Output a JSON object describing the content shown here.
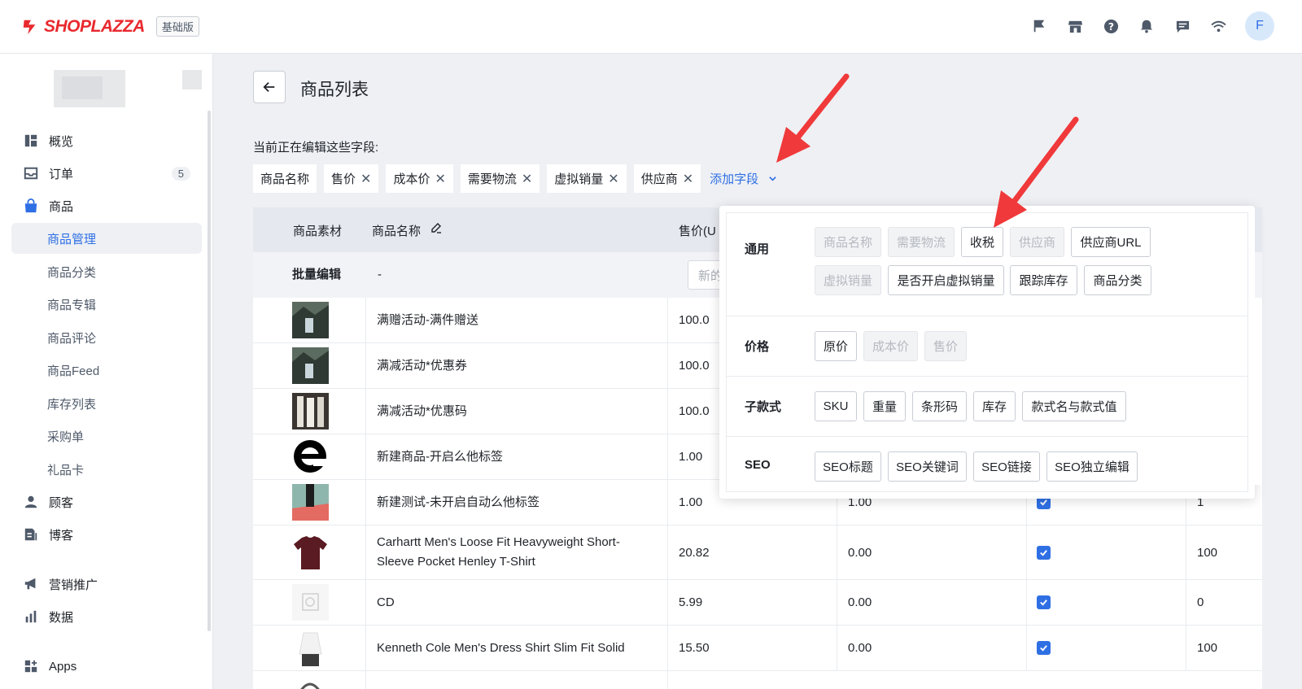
{
  "header": {
    "logo_text": "SHOPLAZZA",
    "plan_badge": "基础版",
    "avatar_letter": "F",
    "icons": [
      "flag-icon",
      "store-icon",
      "help-icon",
      "bell-icon",
      "message-icon",
      "wifi-icon"
    ]
  },
  "sidebar": {
    "items": [
      {
        "label": "概览",
        "icon": "dashboard-icon"
      },
      {
        "label": "订单",
        "icon": "inbox-icon",
        "count": "5"
      },
      {
        "label": "商品",
        "icon": "shopping-bag-icon"
      },
      {
        "label": "顾客",
        "icon": "person-icon"
      },
      {
        "label": "博客",
        "icon": "blog-icon"
      },
      {
        "label": "营销推广",
        "icon": "megaphone-icon"
      },
      {
        "label": "数据",
        "icon": "bar-chart-icon"
      },
      {
        "label": "Apps",
        "icon": "apps-icon"
      }
    ],
    "product_sub": [
      "商品管理",
      "商品分类",
      "商品专辑",
      "商品评论",
      "商品Feed",
      "库存列表",
      "采购单",
      "礼品卡"
    ]
  },
  "main": {
    "title": "商品列表",
    "editing_label": "当前正在编辑这些字段:",
    "chips": [
      {
        "label": "商品名称",
        "removable": false
      },
      {
        "label": "售价",
        "removable": true
      },
      {
        "label": "成本价",
        "removable": true
      },
      {
        "label": "需要物流",
        "removable": true
      },
      {
        "label": "虚拟销量",
        "removable": true
      },
      {
        "label": "供应商",
        "removable": true
      }
    ],
    "add_field": "添加字段"
  },
  "table": {
    "headers": {
      "material": "商品素材",
      "name": "商品名称",
      "price": "售价(U"
    },
    "batch_label": "批量编辑",
    "batch_dash": "-",
    "batch_placeholder": "新的",
    "rows": [
      {
        "name": "满赠活动-满件赠送",
        "price": "100.0",
        "cost": "",
        "virtual": ""
      },
      {
        "name": "满减活动*优惠券",
        "price": "100.0",
        "cost": "",
        "virtual": ""
      },
      {
        "name": "满减活动*优惠码",
        "price": "100.0",
        "cost": "",
        "virtual": ""
      },
      {
        "name": "新建商品-开启么他标签",
        "price": "1.00",
        "cost": "",
        "virtual": ""
      },
      {
        "name": "新建测试-未开启自动么他标签",
        "price": "1.00",
        "cost": "1.00",
        "virtual": "1"
      },
      {
        "name": "Carhartt Men's Loose Fit Heavyweight Short-Sleeve Pocket Henley T-Shirt",
        "price": "20.82",
        "cost": "0.00",
        "virtual": "100"
      },
      {
        "name": "CD",
        "price": "5.99",
        "cost": "0.00",
        "virtual": "0"
      },
      {
        "name": "Kenneth Cole Men's Dress Shirt Slim Fit Solid",
        "price": "15.50",
        "cost": "0.00",
        "virtual": "100"
      }
    ]
  },
  "popover": {
    "groups": [
      {
        "label": "通用",
        "options": [
          {
            "label": "商品名称",
            "disabled": true
          },
          {
            "label": "需要物流",
            "disabled": true
          },
          {
            "label": "收税",
            "disabled": false
          },
          {
            "label": "供应商",
            "disabled": true
          },
          {
            "label": "供应商URL",
            "disabled": false
          },
          {
            "label": "虚拟销量",
            "disabled": true
          },
          {
            "label": "是否开启虚拟销量",
            "disabled": false
          },
          {
            "label": "跟踪库存",
            "disabled": false
          },
          {
            "label": "商品分类",
            "disabled": false
          }
        ]
      },
      {
        "label": "价格",
        "options": [
          {
            "label": "原价",
            "disabled": false
          },
          {
            "label": "成本价",
            "disabled": true
          },
          {
            "label": "售价",
            "disabled": true
          }
        ]
      },
      {
        "label": "子款式",
        "options": [
          {
            "label": "SKU",
            "disabled": false
          },
          {
            "label": "重量",
            "disabled": false
          },
          {
            "label": "条形码",
            "disabled": false
          },
          {
            "label": "库存",
            "disabled": false
          },
          {
            "label": "款式名与款式值",
            "disabled": false
          }
        ]
      },
      {
        "label": "SEO",
        "options": [
          {
            "label": "SEO标题",
            "disabled": false
          },
          {
            "label": "SEO关键词",
            "disabled": false
          },
          {
            "label": "SEO链接",
            "disabled": false
          },
          {
            "label": "SEO独立编辑",
            "disabled": false
          }
        ]
      }
    ]
  },
  "colors": {
    "accent": "#2f6fe4",
    "brand": "#e8292e",
    "annotation": "#f0393a"
  }
}
